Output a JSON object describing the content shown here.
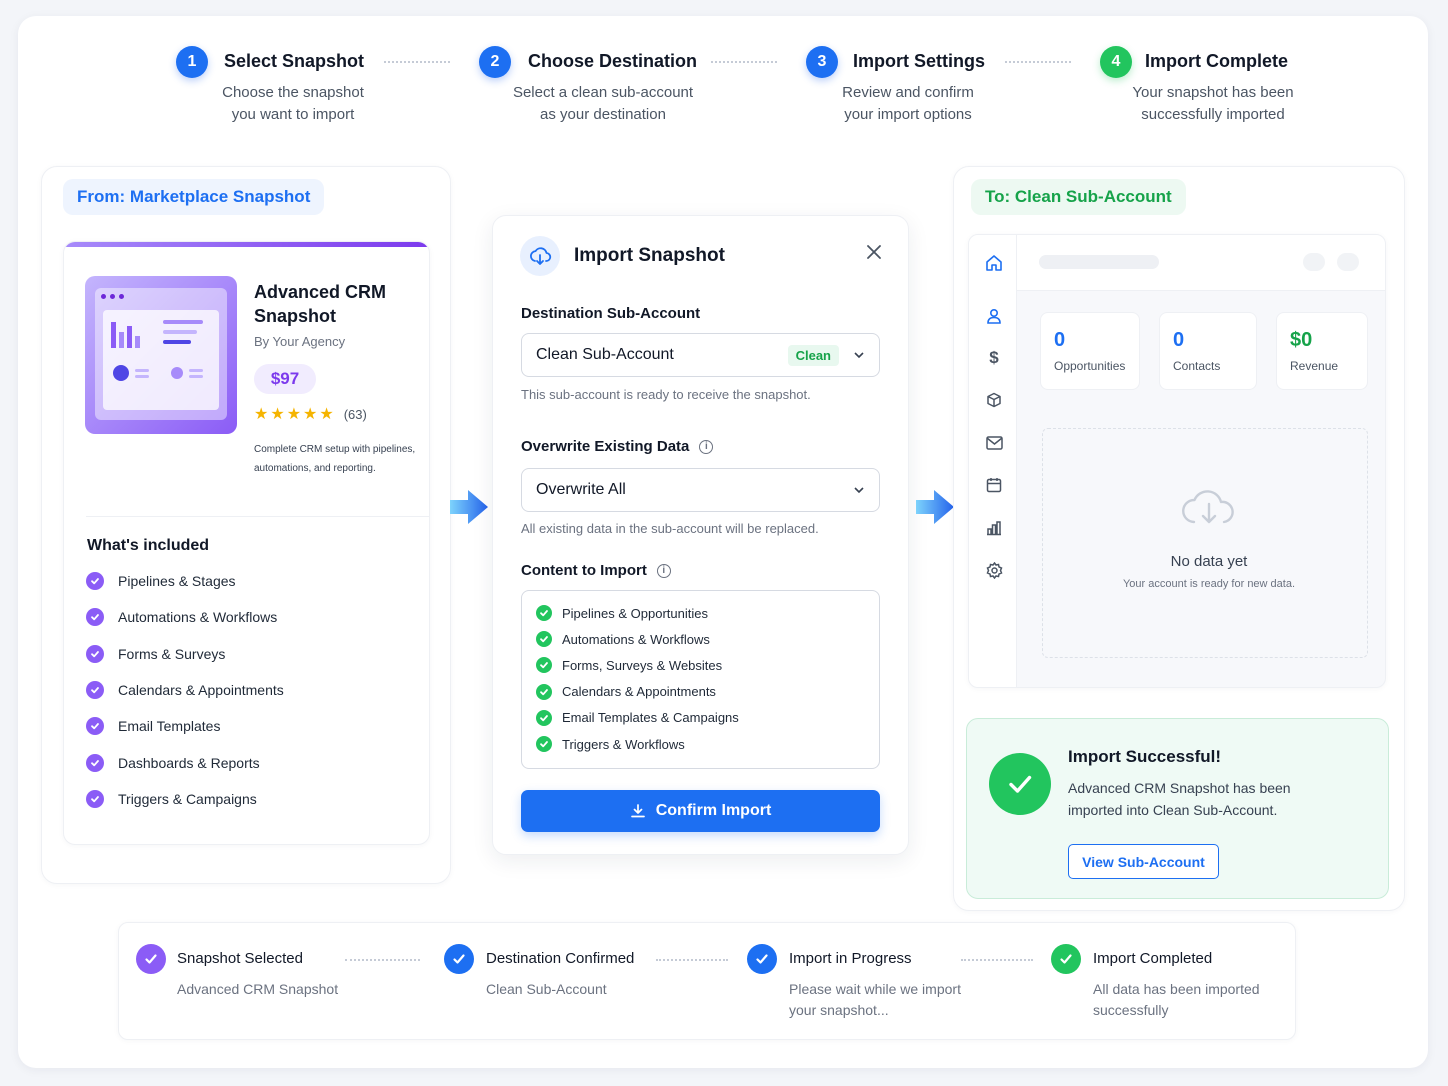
{
  "colors": {
    "primary": "#1d6ff2",
    "purple": "#8b5cf6",
    "green": "#22c55e",
    "success_bg": "#effaf5"
  },
  "steps": [
    {
      "number": "1",
      "title": "Select Snapshot",
      "desc1": "Choose the snapshot",
      "desc2": "you want to import"
    },
    {
      "number": "2",
      "title": "Choose Destination",
      "desc1": "Select a clean sub-account",
      "desc2": "as your destination"
    },
    {
      "number": "3",
      "title": "Import Settings",
      "desc1": "Review and confirm",
      "desc2": "your import options"
    },
    {
      "number": "4",
      "title": "Import Complete",
      "desc1": "Your snapshot has been",
      "desc2": "successfully imported"
    }
  ],
  "source": {
    "label_prefix": "From:",
    "label_value": "Marketplace Snapshot",
    "product_title_1": "Advanced CRM",
    "product_title_2": "Snapshot",
    "author": "By Your Agency",
    "price": "$97",
    "rating": 5,
    "rating_count": "(63)",
    "desc1": "Complete CRM setup with pipelines,",
    "desc2": "automations, and reporting.",
    "included_heading": "What's included",
    "included": [
      "Pipelines & Stages",
      "Automations & Workflows",
      "Forms & Surveys",
      "Calendars & Appointments",
      "Email Templates",
      "Dashboards & Reports",
      "Triggers & Campaigns"
    ]
  },
  "modal": {
    "title": "Import Snapshot",
    "destination_label": "Destination Sub-Account",
    "destination_value": "Clean Sub-Account",
    "destination_badge": "Clean",
    "destination_hint": "This sub-account is ready to receive the snapshot.",
    "overwrite_label": "Overwrite Existing Data",
    "overwrite_value": "Overwrite All",
    "overwrite_hint": "All existing data in the sub-account will be replaced.",
    "content_label": "Content to Import",
    "content_items": [
      "Pipelines & Opportunities",
      "Automations & Workflows",
      "Forms, Surveys & Websites",
      "Calendars & Appointments",
      "Email Templates & Campaigns",
      "Triggers & Workflows"
    ],
    "confirm_label": "Confirm Import"
  },
  "destination": {
    "label_prefix": "To:",
    "label_value": "Clean Sub-Account",
    "stats": [
      {
        "value": "0",
        "label": "Opportunities"
      },
      {
        "value": "0",
        "label": "Contacts"
      },
      {
        "value": "$0",
        "label": "Revenue"
      }
    ],
    "empty_title": "No data yet",
    "empty_desc": "Your account is ready for new data."
  },
  "success": {
    "title": "Import Successful!",
    "desc1": "Advanced CRM Snapshot has been",
    "desc2": "imported into Clean Sub-Account.",
    "button": "View Sub-Account"
  },
  "progress": [
    {
      "title": "Snapshot Selected",
      "desc1": "Advanced CRM Snapshot",
      "desc2": ""
    },
    {
      "title": "Destination Confirmed",
      "desc1": "Clean Sub-Account",
      "desc2": ""
    },
    {
      "title": "Import in Progress",
      "desc1": "Please wait while we import",
      "desc2": "your snapshot..."
    },
    {
      "title": "Import Completed",
      "desc1": "All data has been imported",
      "desc2": "successfully"
    }
  ]
}
